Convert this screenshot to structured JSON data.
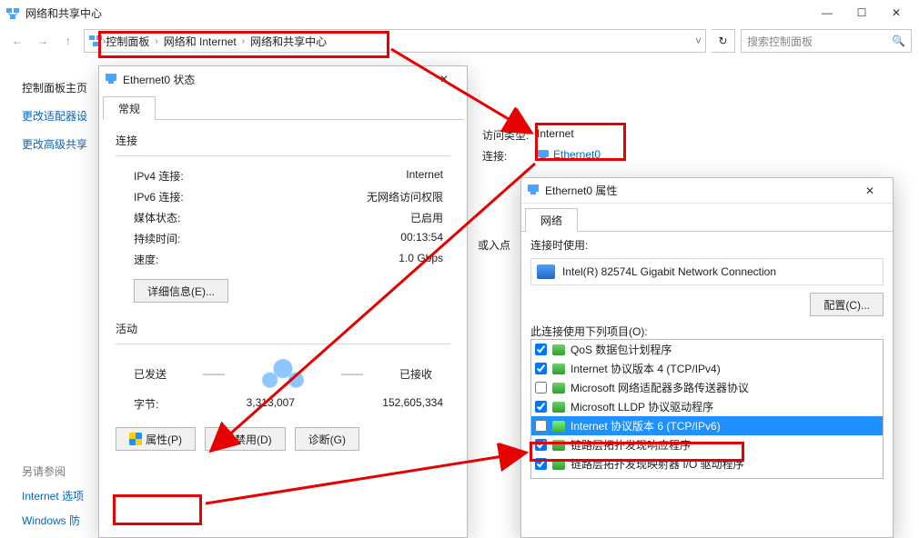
{
  "main": {
    "title": "网络和共享中心",
    "breadcrumb": [
      "控制面板",
      "网络和 Internet",
      "网络和共享中心"
    ],
    "search_placeholder": "搜索控制面板",
    "side": {
      "cp_home": "控制面板主页",
      "adapter": "更改适配器设",
      "advanced": "更改高级共享"
    },
    "access_type_label": "访问类型:",
    "access_type_value": "Internet",
    "connection_label": "连接:",
    "connection_value": "Ethernet0",
    "access_point_label": "或入点",
    "see_also": {
      "title": "另请参阅",
      "internet_opts": "Internet 选项",
      "win_fire": "Windows 防"
    }
  },
  "status": {
    "title": "Ethernet0 状态",
    "tab_general": "常规",
    "conn_group": "连接",
    "ipv4_label": "IPv4 连接:",
    "ipv4_value": "Internet",
    "ipv6_label": "IPv6 连接:",
    "ipv6_value": "无网络访问权限",
    "media_label": "媒体状态:",
    "media_value": "已启用",
    "duration_label": "持续时间:",
    "duration_value": "00:13:54",
    "speed_label": "速度:",
    "speed_value": "1.0 Gbps",
    "details_btn": "详细信息(E)...",
    "activity_group": "活动",
    "sent_label": "已发送",
    "recv_label": "已接收",
    "bytes_label": "字节:",
    "bytes_sent": "3,313,007",
    "bytes_recv": "152,605,334",
    "props_btn": "属性(P)",
    "disable_btn": "禁用(D)",
    "diag_btn": "诊断(G)"
  },
  "props": {
    "title": "Ethernet0 属性",
    "tab_net": "网络",
    "connect_using": "连接时使用:",
    "nic": "Intel(R) 82574L Gigabit Network Connection",
    "configure_btn": "配置(C)...",
    "items_label": "此连接使用下列项目(O):",
    "items": [
      {
        "checked": true,
        "label": "QoS 数据包计划程序"
      },
      {
        "checked": true,
        "label": "Internet 协议版本 4 (TCP/IPv4)"
      },
      {
        "checked": false,
        "label": "Microsoft 网络适配器多路传送器协议"
      },
      {
        "checked": true,
        "label": "Microsoft LLDP 协议驱动程序"
      },
      {
        "checked": false,
        "label": "Internet 协议版本 6 (TCP/IPv6)",
        "selected": true
      },
      {
        "checked": true,
        "label": "链路层拓扑发现响应程序"
      },
      {
        "checked": true,
        "label": "链路层拓扑发现映射器 I/O 驱动程序"
      }
    ]
  }
}
